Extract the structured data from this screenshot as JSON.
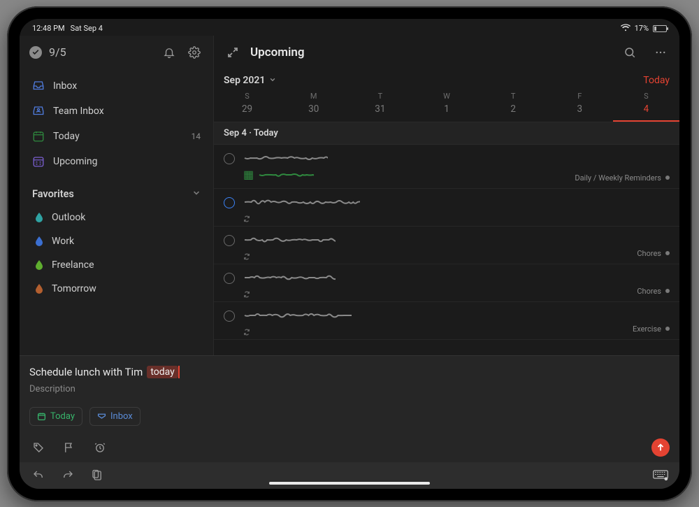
{
  "status": {
    "time": "12:48 PM",
    "date": "Sat Sep 4",
    "battery_pct": "17%",
    "battery_fill_pct": 17
  },
  "sidebar": {
    "summary": "9/5",
    "items": [
      {
        "label": "Inbox",
        "icon": "inbox",
        "color": "#4f7bdc"
      },
      {
        "label": "Team Inbox",
        "icon": "team-inbox",
        "color": "#4f7bdc"
      },
      {
        "label": "Today",
        "icon": "today",
        "color": "#2f8a3f",
        "count": "14"
      },
      {
        "label": "Upcoming",
        "icon": "upcoming",
        "color": "#7a5fcf"
      }
    ],
    "favorites_header": "Favorites",
    "favorites": [
      {
        "label": "Outlook",
        "color": "#2fa3a3"
      },
      {
        "label": "Work",
        "color": "#3b6fd1"
      },
      {
        "label": "Freelance",
        "color": "#5fae2f"
      },
      {
        "label": "Tomorrow",
        "color": "#b35f2f"
      }
    ]
  },
  "main": {
    "title": "Upcoming",
    "month": "Sep 2021",
    "today_link": "Today",
    "week": {
      "labels": [
        "S",
        "M",
        "T",
        "W",
        "T",
        "F",
        "S"
      ],
      "nums": [
        "29",
        "30",
        "31",
        "1",
        "2",
        "3",
        "4"
      ],
      "today_index": 6
    },
    "section_label": "Sep 4 · Today",
    "tasks": [
      {
        "meta": "Daily / Weekly Reminders",
        "ring": "gray",
        "green_sub": true
      },
      {
        "meta": "",
        "ring": "blue"
      },
      {
        "meta": "Chores",
        "ring": "gray"
      },
      {
        "meta": "Chores",
        "ring": "gray"
      },
      {
        "meta": "Exercise",
        "ring": "gray"
      }
    ]
  },
  "quick_add": {
    "title_prefix": "Schedule lunch with Tim",
    "title_pill": "today",
    "description_placeholder": "Description",
    "chips": {
      "today": "Today",
      "inbox": "Inbox"
    }
  }
}
